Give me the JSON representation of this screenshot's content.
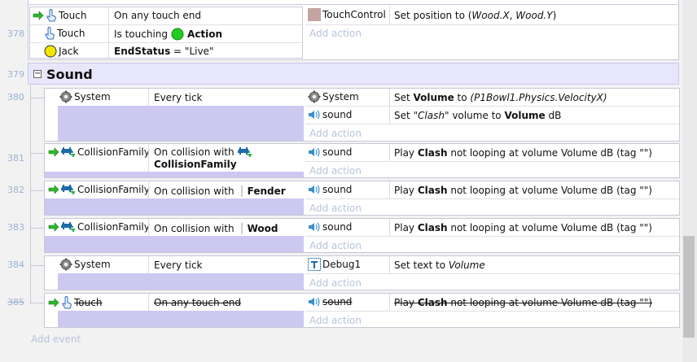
{
  "top_block": {
    "cond1_obj": "Touch",
    "cond1_text": "On any touch end",
    "cond2_obj": "Touch",
    "cond2_text": "Is touching",
    "cond2_target": "Action",
    "cond3_obj": "Jack",
    "cond3_field": "EndStatus",
    "cond3_rest": " = \"Live\"",
    "act1_obj": "TouchControl",
    "act1_pre": "Set position to (",
    "act1_x": "Wood.X",
    "act1_sep": ", ",
    "act1_y": "Wood.Y",
    "act1_post": ")",
    "add_action": "Add action"
  },
  "lines": [
    "378",
    "379",
    "380",
    "381",
    "382",
    "383",
    "384",
    "385"
  ],
  "group": {
    "title": "Sound",
    "toggle": "−"
  },
  "ev380": {
    "cond_obj": "System",
    "cond_text": "Every tick",
    "a1_obj": "System",
    "a1_pre": "Set ",
    "a1_b": "Volume",
    "a1_mid": " to ",
    "a1_i": "(P1Bowl1.Physics.VelocityX)",
    "a2_obj": "sound",
    "a2_pre": "Set ",
    "a2_i": "\"Clash\"",
    "a2_mid": " volume to ",
    "a2_b": "Volume",
    "a2_post": " dB",
    "add_action": "Add action"
  },
  "ev381": {
    "cond_obj": "CollisionFamily",
    "cond_text": "On collision with",
    "cond_target": "CollisionFamily",
    "a1_obj": "sound",
    "a1_pre": "Play ",
    "a1_b": "Clash",
    "a1_post": " not looping at volume Volume dB (tag \"\")",
    "add_action": "Add action"
  },
  "ev382": {
    "cond_obj": "CollisionFamily",
    "cond_text": "On collision with",
    "cond_target": "Fender",
    "a1_obj": "sound",
    "a1_pre": "Play ",
    "a1_b": "Clash",
    "a1_post": " not looping at volume Volume dB (tag \"\")",
    "add_action": "Add action"
  },
  "ev383": {
    "cond_obj": "CollisionFamily",
    "cond_text": "On collision with",
    "cond_target": "Wood",
    "a1_obj": "sound",
    "a1_pre": "Play ",
    "a1_b": "Clash",
    "a1_post": " not looping at volume Volume dB (tag \"\")",
    "add_action": "Add action"
  },
  "ev384": {
    "cond_obj": "System",
    "cond_text": "Every tick",
    "a1_obj": "Debug1",
    "a1_pre": "Set text to ",
    "a1_i": "Volume",
    "add_action": "Add action"
  },
  "ev385": {
    "cond_obj": "Touch",
    "cond_text": "On any touch end",
    "a1_obj": "sound",
    "a1_pre": "Play ",
    "a1_b": "Clash",
    "a1_post": " not looping at volume Volume dB (tag \"\")",
    "add_action": "Add action"
  },
  "add_event": "Add event",
  "colors": {
    "lavender": "#ccc8f0",
    "addText": "#b6c4dc",
    "lineNum": "#9ab4d6",
    "green": "#22cc22",
    "yellow": "#f2e600"
  }
}
